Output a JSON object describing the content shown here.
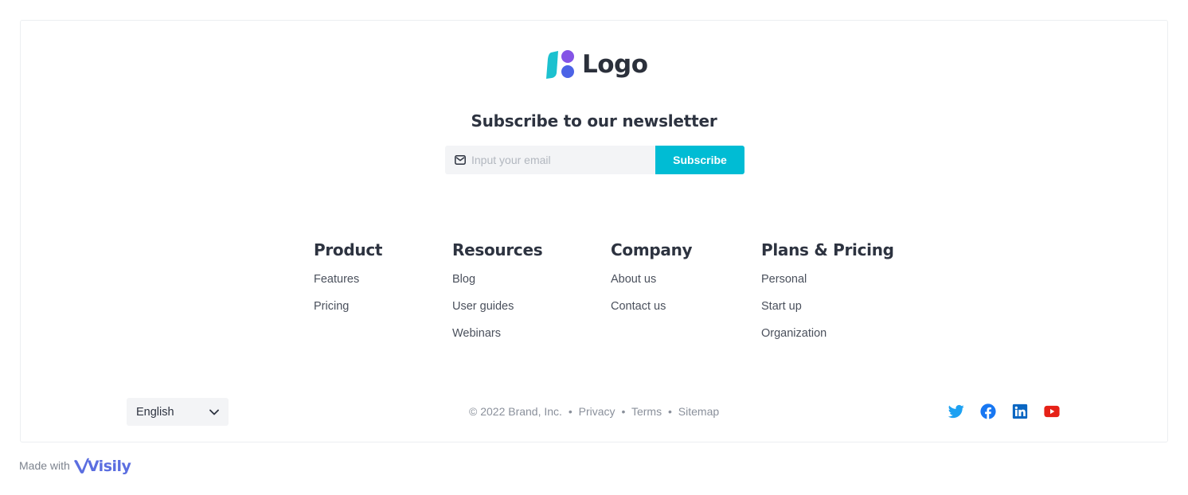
{
  "brand": {
    "logo_text": "Logo",
    "colors": {
      "accent": "#00bcd4",
      "logo_teal": "#1cc1cf",
      "logo_purple": "#8454e6",
      "logo_blue": "#4c63e6"
    }
  },
  "newsletter": {
    "title": "Subscribe to our newsletter",
    "email_placeholder": "Input your email",
    "email_value": "",
    "subscribe_label": "Subscribe",
    "icon": "mail-icon"
  },
  "columns": [
    {
      "title": "Product",
      "links": [
        "Features",
        "Pricing"
      ]
    },
    {
      "title": "Resources",
      "links": [
        "Blog",
        "User guides",
        "Webinars"
      ]
    },
    {
      "title": "Company",
      "links": [
        "About us",
        "Contact us"
      ]
    },
    {
      "title": "Plans & Pricing",
      "links": [
        "Personal",
        "Start up",
        "Organization"
      ]
    }
  ],
  "language": {
    "selected": "English",
    "icon": "chevron-down-icon"
  },
  "legal": {
    "copyright": "© 2022 Brand, Inc.",
    "separator": "•",
    "links": [
      "Privacy",
      "Terms",
      "Sitemap"
    ]
  },
  "socials": [
    {
      "name": "twitter-icon",
      "color": "#1da1f2"
    },
    {
      "name": "facebook-icon",
      "color": "#1877f2"
    },
    {
      "name": "linkedin-icon",
      "color": "#0a66c2"
    },
    {
      "name": "youtube-icon",
      "color": "#e62117"
    }
  ],
  "made_with": {
    "label": "Made with",
    "brand": "Visily",
    "color": "#5b6ee0"
  }
}
